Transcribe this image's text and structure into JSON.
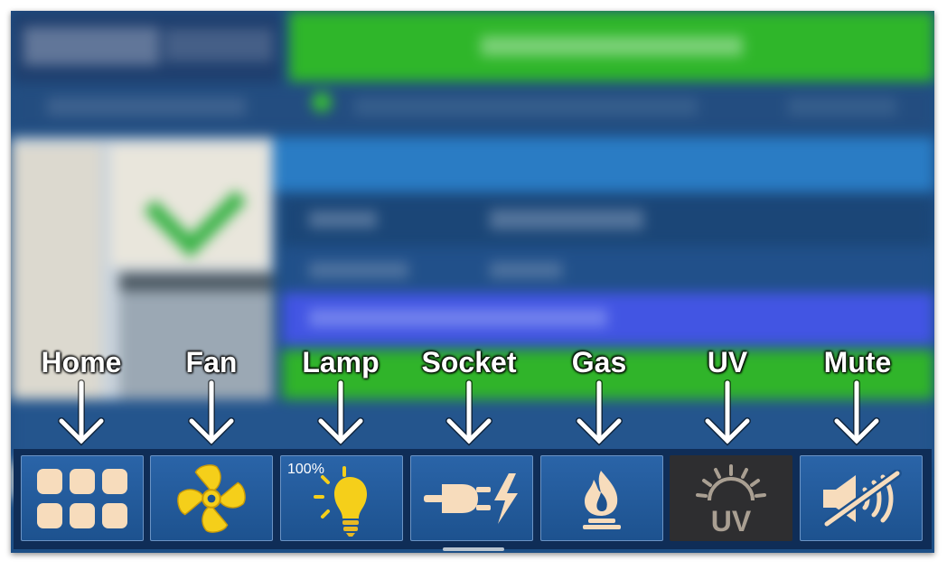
{
  "labels": {
    "home": "Home",
    "fan": "Fan",
    "lamp": "Lamp",
    "socket": "Socket",
    "gas": "Gas",
    "uv": "UV",
    "mute": "Mute"
  },
  "toolbar": {
    "lamp_level": "100%",
    "uv_icon_text": "UV",
    "buttons": [
      {
        "id": "home",
        "icon": "grid-icon",
        "state": "normal"
      },
      {
        "id": "fan",
        "icon": "fan-icon",
        "state": "on"
      },
      {
        "id": "lamp",
        "icon": "lightbulb-icon",
        "state": "on"
      },
      {
        "id": "socket",
        "icon": "plug-icon",
        "state": "normal"
      },
      {
        "id": "gas",
        "icon": "flame-icon",
        "state": "normal"
      },
      {
        "id": "uv",
        "icon": "uv-icon",
        "state": "selected"
      },
      {
        "id": "mute",
        "icon": "speaker-muted-icon",
        "state": "normal"
      }
    ]
  },
  "colors": {
    "toolbar_bg": "#0f2d57",
    "button_blue": "#2a64a8",
    "button_dark": "#2e2e30",
    "icon_cream": "#f7dcbc",
    "icon_yellow": "#f5cf1a",
    "icon_grey": "#a99f92"
  }
}
